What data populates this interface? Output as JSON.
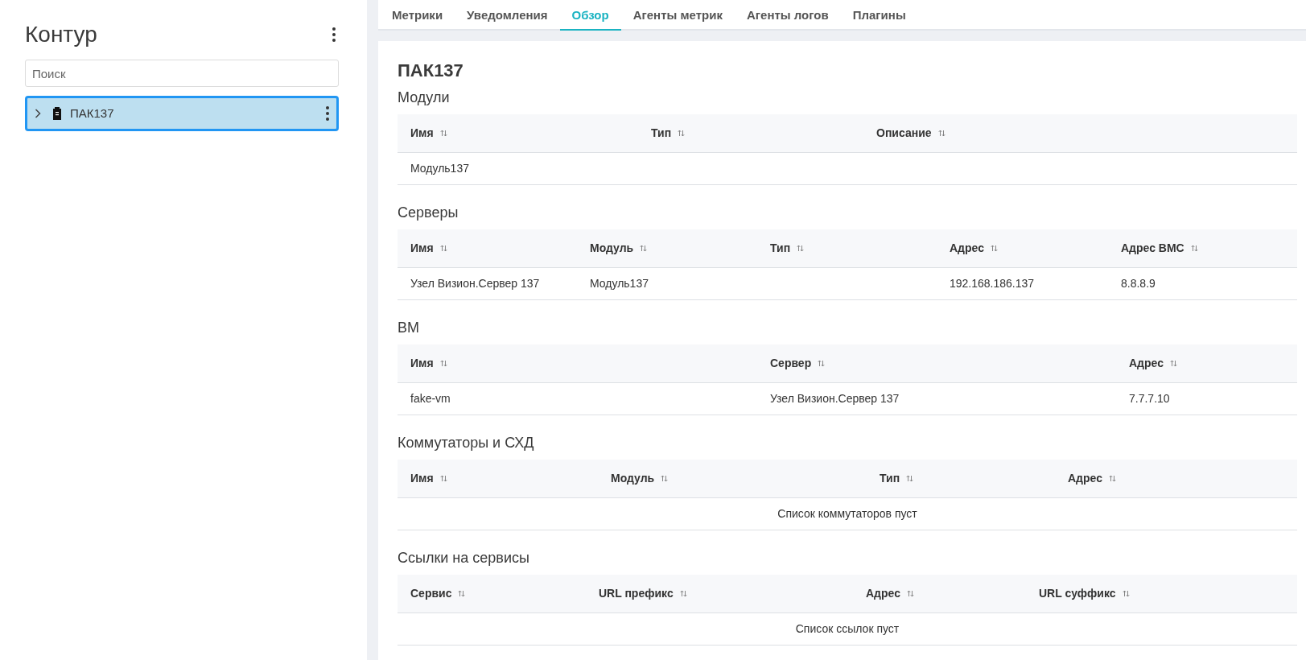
{
  "sidebar": {
    "title": "Контур",
    "search": {
      "placeholder": "Поиск"
    },
    "tree": [
      {
        "label": "ПАК137",
        "selected": true,
        "expanded": false
      }
    ]
  },
  "tabs": [
    {
      "label": "Метрики",
      "selected": false
    },
    {
      "label": "Уведомления",
      "selected": false
    },
    {
      "label": "Обзор",
      "selected": true
    },
    {
      "label": "Агенты метрик",
      "selected": false
    },
    {
      "label": "Агенты логов",
      "selected": false
    },
    {
      "label": "Плагины",
      "selected": false
    }
  ],
  "page_title": "ПАК137",
  "sections": [
    {
      "title": "Модули",
      "columns": [
        "Имя",
        "Тип",
        "Описание"
      ],
      "rows": [
        [
          "Модуль137",
          "",
          ""
        ]
      ]
    },
    {
      "title": "Серверы",
      "columns": [
        "Имя",
        "Модуль",
        "Тип",
        "Адрес",
        "Адрес BMC"
      ],
      "rows": [
        [
          "Узел Визион.Сервер 137",
          "Модуль137",
          "",
          "192.168.186.137",
          "8.8.8.9"
        ]
      ]
    },
    {
      "title": "ВМ",
      "columns": [
        "Имя",
        "Сервер",
        "Адрес"
      ],
      "rows": [
        [
          "fake-vm",
          "Узел Визион.Сервер 137",
          "7.7.7.10"
        ]
      ]
    },
    {
      "title": "Коммутаторы и СХД",
      "columns": [
        "Имя",
        "Модуль",
        "Тип",
        "Адрес"
      ],
      "empty_text": "Список коммутаторов пуст"
    },
    {
      "title": "Ссылки на сервисы",
      "columns": [
        "Сервис",
        "URL префикс",
        "Адрес",
        "URL суффикс"
      ],
      "empty_text": "Список ссылок пуст"
    }
  ]
}
